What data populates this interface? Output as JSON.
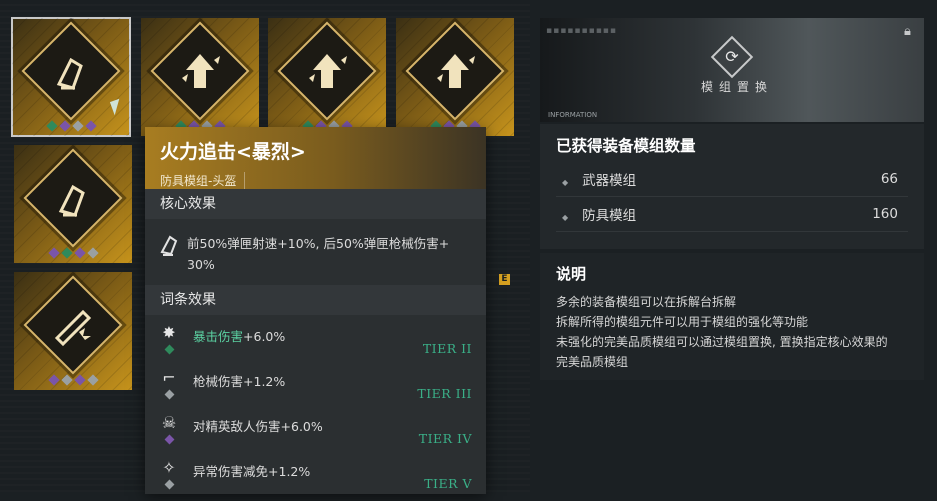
{
  "modules": [
    {
      "id": "m1",
      "icon": "armor-arm-icon",
      "glyph": "✍",
      "gems": [
        "green",
        "purple",
        "grey",
        "purple"
      ],
      "selected": true
    },
    {
      "id": "m2",
      "icon": "burst-arrow-icon",
      "glyph": "⇧",
      "gems": [
        "green",
        "purple",
        "grey",
        "purple"
      ]
    },
    {
      "id": "m3",
      "icon": "burst-arrow-icon",
      "glyph": "⇧",
      "gems": [
        "green",
        "purple",
        "grey",
        "purple"
      ]
    },
    {
      "id": "m4",
      "icon": "burst-arrow-icon",
      "glyph": "⇧",
      "gems": [
        "green",
        "purple",
        "grey",
        "purple"
      ]
    },
    {
      "id": "m5",
      "icon": "armor-arm-icon",
      "glyph": "✍",
      "gems": [
        "purple",
        "green",
        "purple",
        "grey"
      ]
    },
    {
      "id": "m6",
      "icon": "gun-burst-icon",
      "glyph": "✦",
      "gems": [
        "purple",
        "grey",
        "purple",
        "grey"
      ]
    }
  ],
  "tooltip": {
    "title": "火力追击<暴烈>",
    "subtitle": "防具模组-头盔",
    "core_header": "核心效果",
    "core_text_1": "前50%弹匣射速+10%, 后50%弹匣枪械伤害+",
    "core_text_2": "30%",
    "affix_header": "词条效果",
    "affixes": [
      {
        "icon": "crit-burst-icon",
        "glyph": "✸",
        "gem": "#2f8a5c",
        "name": "暴击伤害",
        "value": "+6.0%",
        "highlight": true,
        "tier": "TIER II"
      },
      {
        "icon": "pistol-icon",
        "glyph": "⌐",
        "gem": "#9aa0a3",
        "name": "枪械伤害",
        "value": "+1.2%",
        "highlight": false,
        "tier": "TIER III"
      },
      {
        "icon": "elite-skull-icon",
        "glyph": "☠",
        "gem": "#7a55a8",
        "name": "对精英敌人伤害",
        "value": "+6.0%",
        "highlight": false,
        "tier": "TIER IV"
      },
      {
        "icon": "status-shield-icon",
        "glyph": "✧",
        "gem": "#9aa0a3",
        "name": "异常伤害减免",
        "value": "+1.2%",
        "highlight": false,
        "tier": "TIER V"
      }
    ]
  },
  "banner": {
    "label": "模组置换",
    "info_text": "INFORMATION"
  },
  "stats": {
    "title": "已获得装备模组数量",
    "rows": [
      {
        "label": "武器模组",
        "value": "66"
      },
      {
        "label": "防具模组",
        "value": "160"
      }
    ]
  },
  "explain": {
    "title": "说明",
    "lines": [
      "多余的装备模组可以在拆解台拆解",
      "拆解所得的模组元件可以用于模组的强化等功能",
      "未强化的完美品质模组可以通过模组置换, 置换指定核心效果的",
      "完美品质模组"
    ]
  },
  "e_mark": "E",
  "colors": {
    "accent_gold": "#c7941c",
    "tier_green": "#3ab088",
    "highlight_green": "#5bd1a2"
  }
}
